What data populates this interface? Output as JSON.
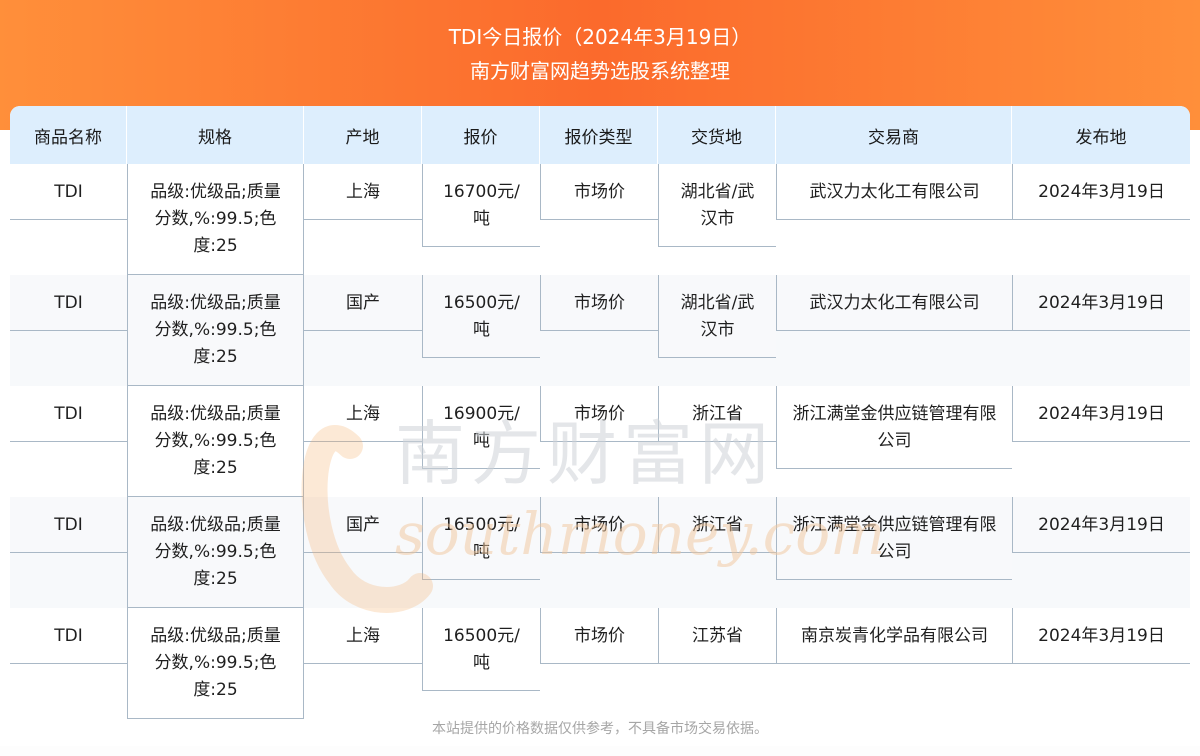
{
  "header": {
    "title": "TDI今日报价（2024年3月19日）",
    "subtitle": "南方财富网趋势选股系统整理"
  },
  "table": {
    "columns": [
      "商品名称",
      "规格",
      "产地",
      "报价",
      "报价类型",
      "交货地",
      "交易商",
      "发布地"
    ],
    "rows": [
      {
        "name": "TDI",
        "spec": "品级:优级品;质量分数,%:99.5;色度:25",
        "origin": "上海",
        "price": "16700元/吨",
        "price_type": "市场价",
        "delivery": "湖北省/武汉市",
        "trader": "武汉力太化工有限公司",
        "date": "2024年3月19日"
      },
      {
        "name": "TDI",
        "spec": "品级:优级品;质量分数,%:99.5;色度:25",
        "origin": "国产",
        "price": "16500元/吨",
        "price_type": "市场价",
        "delivery": "湖北省/武汉市",
        "trader": "武汉力太化工有限公司",
        "date": "2024年3月19日"
      },
      {
        "name": "TDI",
        "spec": "品级:优级品;质量分数,%:99.5;色度:25",
        "origin": "上海",
        "price": "16900元/吨",
        "price_type": "市场价",
        "delivery": "浙江省",
        "trader": "浙江满堂金供应链管理有限公司",
        "date": "2024年3月19日"
      },
      {
        "name": "TDI",
        "spec": "品级:优级品;质量分数,%:99.5;色度:25",
        "origin": "国产",
        "price": "16500元/吨",
        "price_type": "市场价",
        "delivery": "浙江省",
        "trader": "浙江满堂金供应链管理有限公司",
        "date": "2024年3月19日"
      },
      {
        "name": "TDI",
        "spec": "品级:优级品;质量分数,%:99.5;色度:25",
        "origin": "上海",
        "price": "16500元/吨",
        "price_type": "市场价",
        "delivery": "江苏省",
        "trader": "南京炭青化学品有限公司",
        "date": "2024年3月19日"
      }
    ]
  },
  "watermark": {
    "cn": "南方财富网",
    "en": "southmoney.com"
  },
  "footer": {
    "disclaimer": "本站提供的价格数据仅供参考，不具备市场交易依据。"
  },
  "colors": {
    "banner": "#fb6a2c",
    "header_bg": "#ddeefd",
    "border": "#a9b8c6"
  }
}
